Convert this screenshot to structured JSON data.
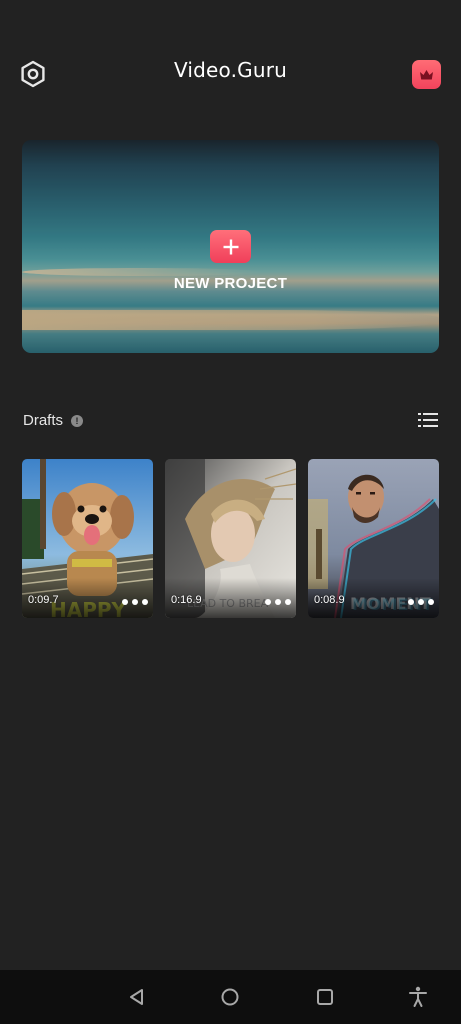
{
  "app": {
    "title": "Video.Guru"
  },
  "top_bar": {
    "settings_icon": "hexagon-gear-icon",
    "premium_icon": "crown-icon",
    "premium_color": "#f2435c"
  },
  "new_project": {
    "label": "NEW PROJECT",
    "plus_icon": "plus-icon",
    "accent_color": "#f03f5a"
  },
  "drafts": {
    "title": "Drafts",
    "info_icon": "info-icon",
    "list_view_icon": "list-view-icon",
    "items": [
      {
        "duration": "0:09.7",
        "thumbnail": "dog-with-happy-text"
      },
      {
        "duration": "0:16.9",
        "thumbnail": "woman-windy-hair"
      },
      {
        "duration": "0:08.9",
        "thumbnail": "man-glitch-moment"
      }
    ]
  },
  "nav_bar": {
    "back_icon": "back-triangle-icon",
    "home_icon": "home-circle-icon",
    "recents_icon": "recents-square-icon",
    "accessibility_icon": "accessibility-icon"
  }
}
